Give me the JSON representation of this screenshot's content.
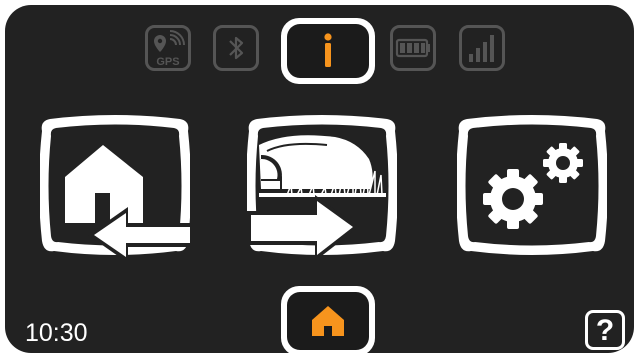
{
  "status_bar": {
    "gps_label": "GPS",
    "gps_icon": "gps-signal-icon",
    "bluetooth_icon": "bluetooth-icon",
    "info_icon": "info-icon",
    "battery_icon": "battery-icon",
    "signal_icon": "cellular-signal-icon"
  },
  "tiles": {
    "park": {
      "icon": "park-home-icon"
    },
    "start": {
      "icon": "start-mowing-icon"
    },
    "settings": {
      "icon": "settings-gears-icon"
    }
  },
  "bottom_bar": {
    "clock": "10:30",
    "home_icon": "home-icon",
    "help_label": "?"
  },
  "colors": {
    "background": "#222222",
    "accent": "#f7941d",
    "foreground": "#ffffff",
    "dimmed": "#555555"
  }
}
